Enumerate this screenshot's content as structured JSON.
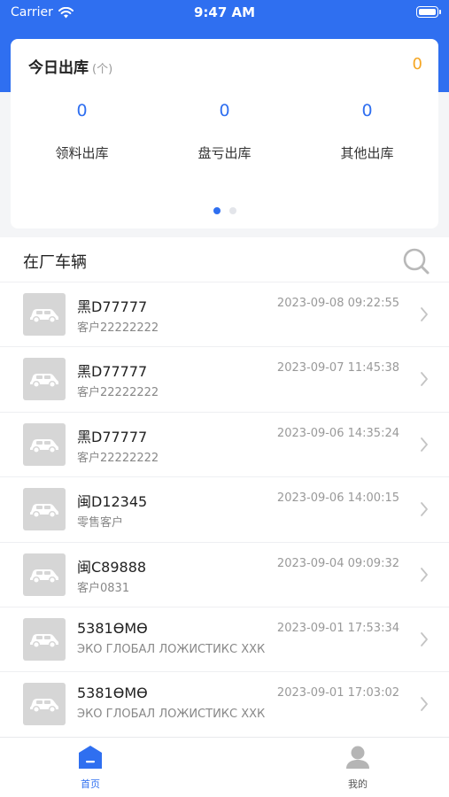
{
  "status_bar": {
    "carrier": "Carrier",
    "time": "9:47 AM"
  },
  "summary": {
    "title": "今日出库",
    "unit": "(个)",
    "total": "0",
    "stats": [
      {
        "label": "领料出库",
        "value": "0"
      },
      {
        "label": "盘亏出库",
        "value": "0"
      },
      {
        "label": "其他出库",
        "value": "0"
      }
    ],
    "pager": {
      "count": 2,
      "active": 1
    }
  },
  "vehicles": {
    "title": "在厂车辆",
    "items": [
      {
        "plate": "黑D77777",
        "customer": "客户22222222",
        "time": "2023-09-08 09:22:55"
      },
      {
        "plate": "黑D77777",
        "customer": "客户22222222",
        "time": "2023-09-07 11:45:38"
      },
      {
        "plate": "黑D77777",
        "customer": "客户22222222",
        "time": "2023-09-06 14:35:24"
      },
      {
        "plate": "闽D12345",
        "customer": "零售客户",
        "time": "2023-09-06 14:00:15"
      },
      {
        "plate": "闽C89888",
        "customer": "客户0831",
        "time": "2023-09-04 09:09:32"
      },
      {
        "plate": "5381ӨМӨ",
        "customer": "ЭКО ГЛОБАЛ ЛОЖИСТИКС ХХК",
        "time": "2023-09-01 17:53:34"
      },
      {
        "plate": "5381ӨМӨ",
        "customer": "ЭКО ГЛОБАЛ ЛОЖИСТИКС ХХК",
        "time": "2023-09-01 17:03:02"
      }
    ]
  },
  "tabbar": {
    "tabs": [
      {
        "label": "首页",
        "icon": "home-icon",
        "active": true
      },
      {
        "label": "我的",
        "icon": "user-icon",
        "active": false
      }
    ]
  },
  "colors": {
    "accent": "#2f6ff0",
    "total": "#f5a623"
  }
}
